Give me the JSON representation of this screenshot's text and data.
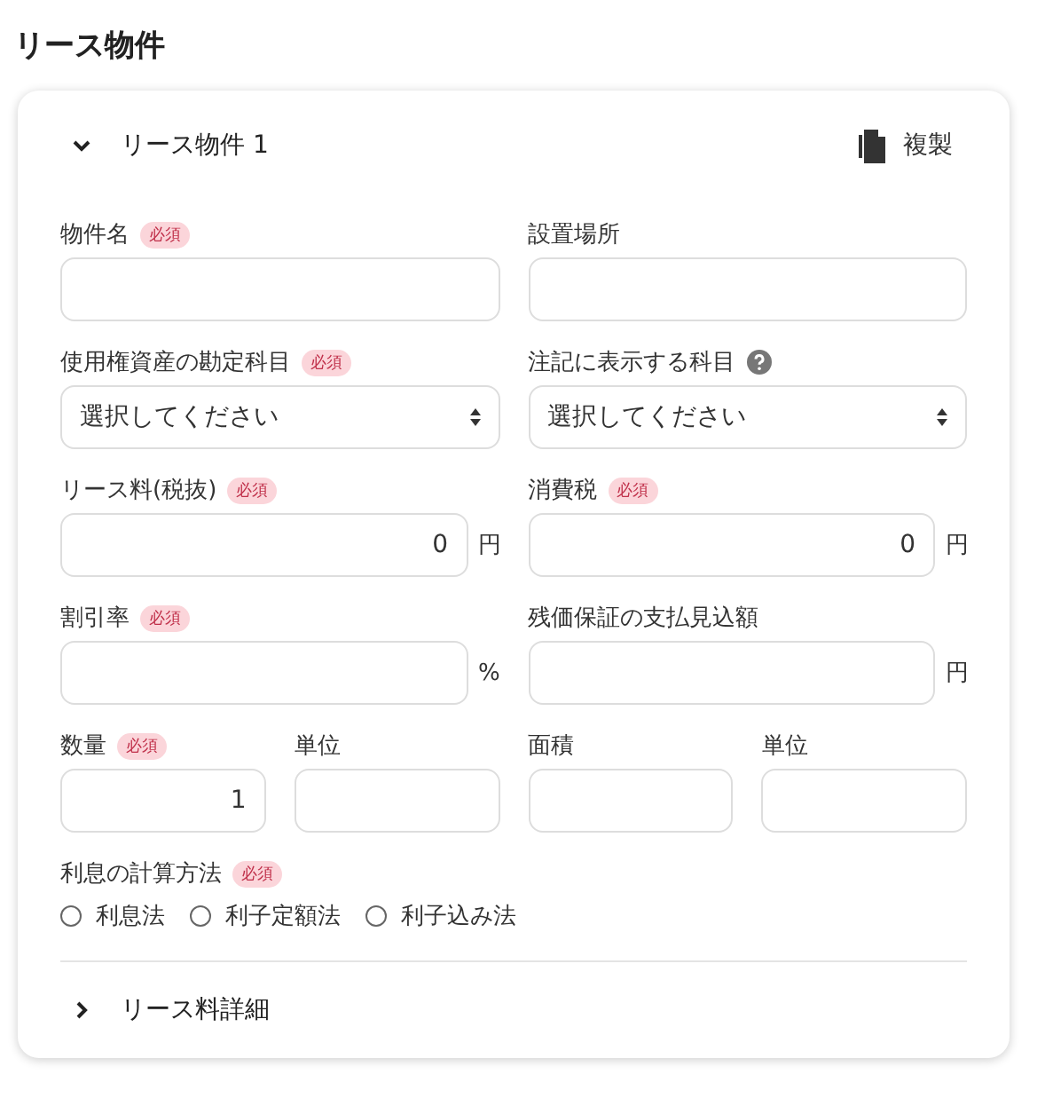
{
  "page_title": "リース物件",
  "item": {
    "title": "リース物件 1",
    "expanded": true,
    "duplicate_label": "複製",
    "rows": [
      [
        {
          "label": "物件名",
          "badge": "必須",
          "kind": "text"
        },
        {
          "label": "設置場所",
          "kind": "text"
        }
      ],
      [
        {
          "label": "使用権資産の勘定科目",
          "badge": "必須",
          "kind": "select",
          "value": "選択してください"
        },
        {
          "label": "注記に表示する科目",
          "help": true,
          "kind": "select",
          "value": "選択してください"
        }
      ],
      [
        {
          "label": "リース料(税抜)",
          "badge": "必須",
          "kind": "number",
          "value": "0",
          "unit": "円"
        },
        {
          "label": "消費税",
          "badge": "必須",
          "kind": "number",
          "value": "0",
          "unit": "円"
        }
      ],
      [
        {
          "label": "割引率",
          "badge": "必須",
          "kind": "number",
          "unit": "%"
        },
        {
          "label": "残価保証の支払見込額",
          "kind": "number",
          "unit": "円"
        }
      ]
    ],
    "quantity_fields": [
      {
        "label": "数量",
        "badge": "必須",
        "kind": "number",
        "value": "1"
      },
      {
        "label": "単位",
        "kind": "text"
      },
      {
        "label": "面積",
        "kind": "text"
      },
      {
        "label": "単位",
        "kind": "text"
      }
    ],
    "interest_method": {
      "label": "利息の計算方法",
      "badge": "必須",
      "options": [
        {
          "label": "利息法",
          "selected": false
        },
        {
          "label": "利子定額法",
          "selected": false
        },
        {
          "label": "利子込み法",
          "selected": false
        }
      ]
    },
    "details": {
      "label": "リース料詳細",
      "expanded": false
    }
  }
}
